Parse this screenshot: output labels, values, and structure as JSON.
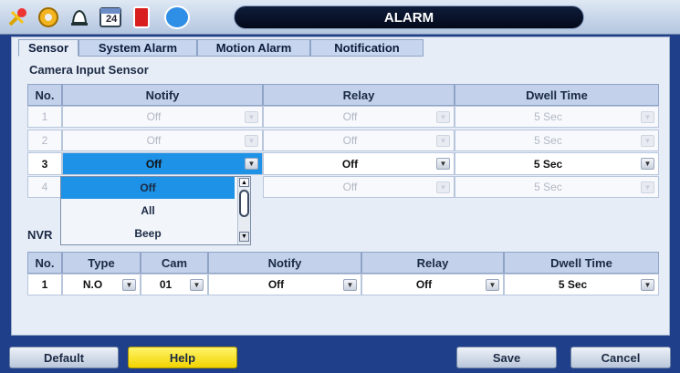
{
  "window": {
    "title": "ALARM"
  },
  "toolbar_icons": [
    "tools-icon",
    "settings-gear-icon",
    "alarm-bell-icon",
    "calendar-icon",
    "record-icon",
    "network-globe-icon"
  ],
  "calendar_day": "24",
  "tabs": [
    "Sensor",
    "System Alarm",
    "Motion Alarm",
    "Notification"
  ],
  "camera_sensor": {
    "title": "Camera Input Sensor",
    "headers": [
      "No.",
      "Notify",
      "Relay",
      "Dwell Time"
    ],
    "rows": [
      {
        "no": "1",
        "notify": "Off",
        "relay": "Off",
        "dwell": "5 Sec",
        "enabled": false
      },
      {
        "no": "2",
        "notify": "Off",
        "relay": "Off",
        "dwell": "5 Sec",
        "enabled": false
      },
      {
        "no": "3",
        "notify": "Off",
        "relay": "Off",
        "dwell": "5 Sec",
        "enabled": true
      },
      {
        "no": "4",
        "notify": "Off",
        "relay": "Off",
        "dwell": "5 Sec",
        "enabled": false
      }
    ]
  },
  "notify_dropdown": {
    "options": [
      "Off",
      "All",
      "Beep"
    ],
    "selected": "Off"
  },
  "nvr_sensor": {
    "title": "NVR",
    "headers": [
      "No.",
      "Type",
      "Cam",
      "Notify",
      "Relay",
      "Dwell Time"
    ],
    "rows": [
      {
        "no": "1",
        "type": "N.O",
        "cam": "01",
        "notify": "Off",
        "relay": "Off",
        "dwell": "5 Sec"
      }
    ]
  },
  "buttons": {
    "default": "Default",
    "help": "Help",
    "save": "Save",
    "cancel": "Cancel"
  },
  "colors": {
    "accent_blue": "#1e92e6",
    "help_yellow": "#f2d400",
    "title_bar": "#03091a"
  }
}
